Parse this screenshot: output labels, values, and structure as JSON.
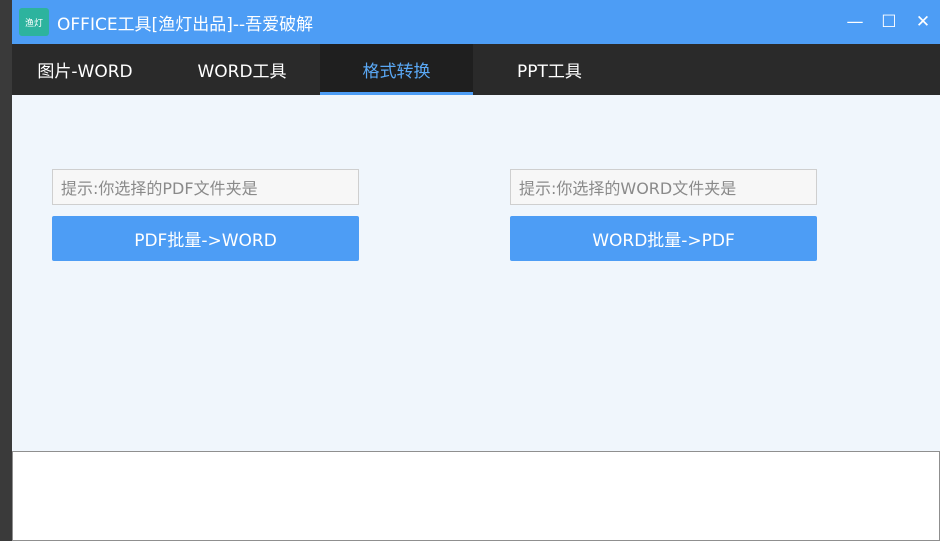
{
  "window": {
    "icon_text": "渔灯",
    "title": "OFFICE工具[渔灯出品]--吾爱破解",
    "minimize": "—",
    "maximize": "☐",
    "close": "✕"
  },
  "tabs": [
    {
      "label": "图片-WORD"
    },
    {
      "label": "WORD工具"
    },
    {
      "label": "格式转换"
    },
    {
      "label": "PPT工具"
    }
  ],
  "active_tab": "格式转换",
  "left_panel": {
    "path_placeholder": "提示:你选择的PDF文件夹是",
    "button_label": "PDF批量->WORD"
  },
  "right_panel": {
    "path_placeholder": "提示:你选择的WORD文件夹是",
    "button_label": "WORD批量->PDF"
  },
  "log": {
    "value": ""
  },
  "colors": {
    "titlebar": "#4d9df5",
    "tabbar": "#2a2a2a",
    "accent": "#4d9df5",
    "background": "#f0f6fc"
  }
}
